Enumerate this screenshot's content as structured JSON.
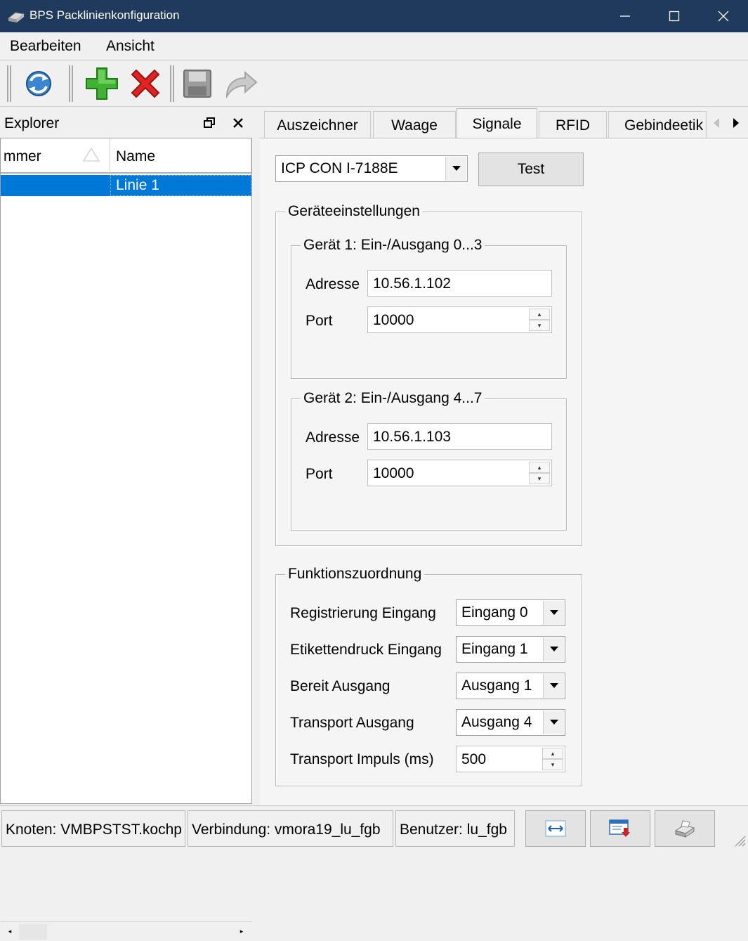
{
  "window": {
    "title": "BPS Packlinienkonfiguration"
  },
  "menu": {
    "items": [
      "Bearbeiten",
      "Ansicht"
    ]
  },
  "explorer": {
    "title": "Explorer",
    "columns": [
      "mmer",
      "Name"
    ],
    "rows": [
      {
        "nummer": "",
        "name": "Linie 1",
        "selected": true
      }
    ]
  },
  "tabs": {
    "items": [
      "Auszeichner",
      "Waage",
      "Signale",
      "RFID",
      "Gebindeetik"
    ],
    "active": "Signale"
  },
  "signale": {
    "device_type": "ICP CON I-7188E",
    "test_label": "Test",
    "geraeteeinstellungen": {
      "legend": "Geräteeinstellungen",
      "geraet1": {
        "legend": "Gerät 1: Ein-/Ausgang 0...3",
        "address_label": "Adresse",
        "address": "10.56.1.102",
        "port_label": "Port",
        "port": "10000"
      },
      "geraet2": {
        "legend": "Gerät 2: Ein-/Ausgang 4...7",
        "address_label": "Adresse",
        "address": "10.56.1.103",
        "port_label": "Port",
        "port": "10000"
      }
    },
    "funktionszuordnung": {
      "legend": "Funktionszuordnung",
      "rows": [
        {
          "label": "Registrierung Eingang",
          "value": "Eingang 0"
        },
        {
          "label": "Etikettendruck Eingang",
          "value": "Eingang 1"
        },
        {
          "label": "Bereit Ausgang",
          "value": "Ausgang 1"
        },
        {
          "label": "Transport Ausgang",
          "value": "Ausgang 4"
        }
      ],
      "impuls_label": "Transport Impuls (ms)",
      "impuls_value": "500"
    }
  },
  "statusbar": {
    "knoten": "Knoten: VMBPSTST.kochp",
    "verbindung": "Verbindung: vmora19_lu_fgb",
    "benutzer": "Benutzer: lu_fgb"
  },
  "colors": {
    "titlebar": "#1f3a5c",
    "selection": "#0078d7"
  }
}
